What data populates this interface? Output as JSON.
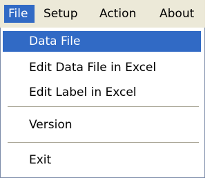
{
  "menubar": {
    "items": [
      {
        "label": "File"
      },
      {
        "label": "Setup"
      },
      {
        "label": "Action"
      },
      {
        "label": "About"
      }
    ]
  },
  "file_menu": {
    "items": [
      {
        "label": "Data File",
        "selected": true
      },
      {
        "label": "Edit Data File in Excel"
      },
      {
        "label": "Edit Label in Excel"
      },
      {
        "label": "Version"
      },
      {
        "label": "Exit"
      }
    ]
  },
  "colors": {
    "highlight": "#316ac5",
    "menubar_bg": "#ece9d8",
    "separator": "#aca899"
  }
}
